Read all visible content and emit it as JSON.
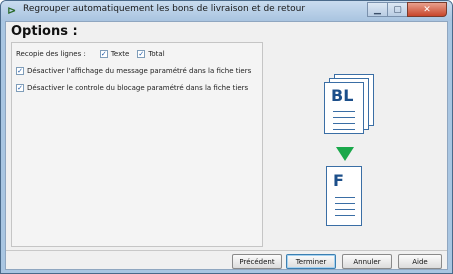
{
  "window": {
    "title": "Regrouper automatiquement les bons de livraison et de retour"
  },
  "options": {
    "heading": "Options :",
    "recopie_label": "Recopie des lignes :",
    "texte_label": "Texte",
    "total_label": "Total",
    "texte_checked": true,
    "total_checked": true,
    "desactiver_message_label": "Désactiver l'affichage du message paramétré dans la fiche tiers",
    "desactiver_message_checked": true,
    "desactiver_controle_label": "Désactiver le controle du blocage paramétré dans la fiche tiers",
    "desactiver_controle_checked": true
  },
  "illustration": {
    "source_doc_label": "BL",
    "target_doc_label": "F",
    "arrow_color": "#1aa84a",
    "doc_color": "#1c4f8a"
  },
  "buttons": {
    "previous": "Précédent",
    "finish": "Terminer",
    "cancel": "Annuler",
    "help": "Aide"
  }
}
